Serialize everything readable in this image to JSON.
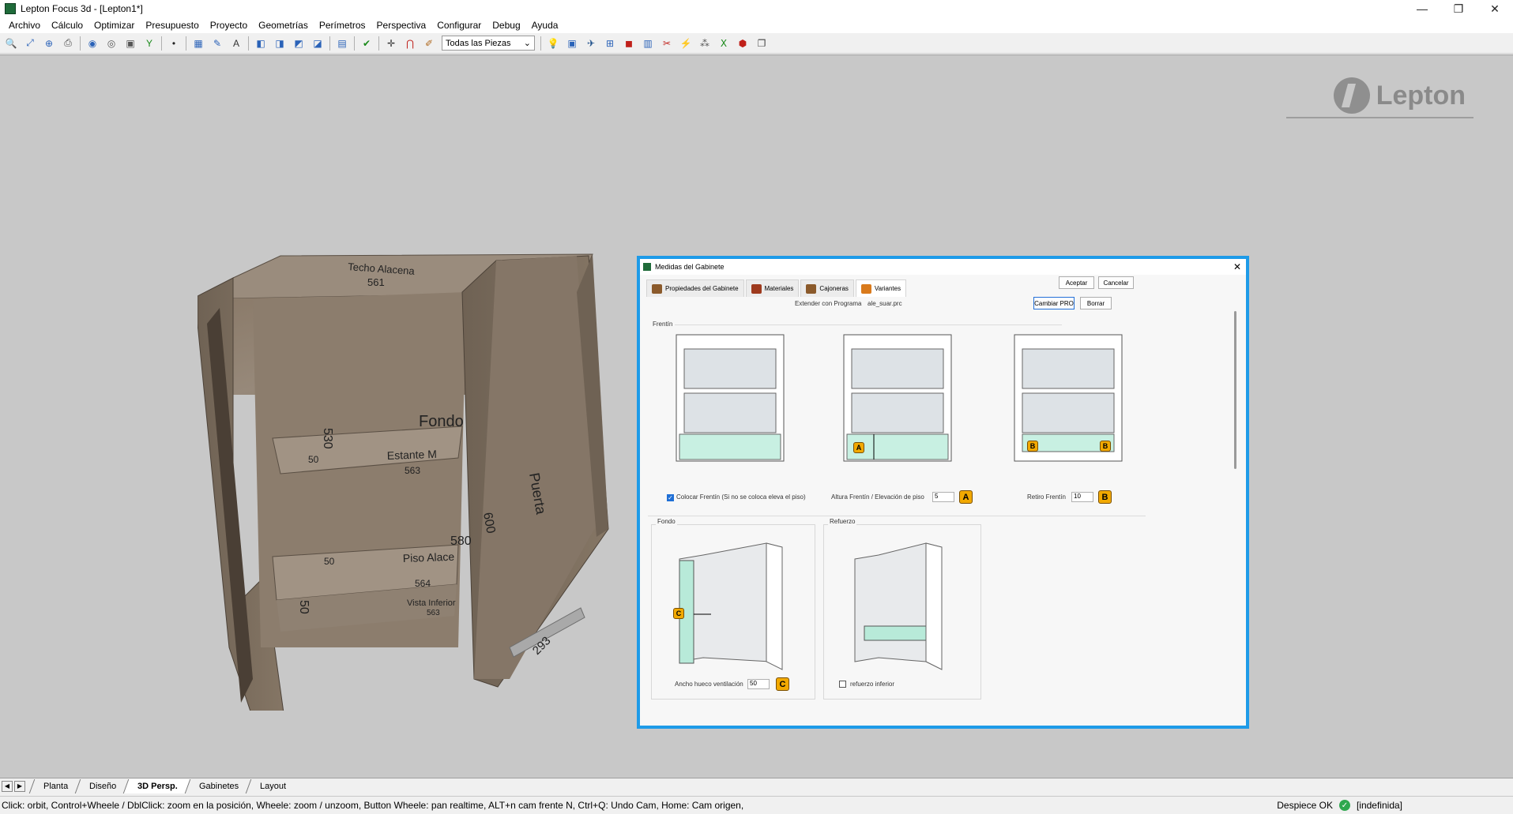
{
  "window": {
    "title": "Lepton Focus 3d - [Lepton1*]",
    "minimize": "—",
    "restore": "❐",
    "close": "✕"
  },
  "menu": [
    "Archivo",
    "Cálculo",
    "Optimizar",
    "Presupuesto",
    "Proyecto",
    "Geometrías",
    "Perímetros",
    "Perspectiva",
    "Configurar",
    "Debug",
    "Ayuda"
  ],
  "toolbar": {
    "piece_filter": "Todas las Piezas"
  },
  "logo": {
    "text": "Lepton"
  },
  "cabinet_labels": {
    "top_panel": "Techo Alacena",
    "top_dim": "561",
    "back": "Fondo",
    "back_dim_side": "530",
    "shelf": "Estante M",
    "shelf_dim": "563",
    "shelf_small": "50",
    "floor": "Piso Alace",
    "floor_dim": "564",
    "floor_small": "50",
    "bottom": "Vista Inferior",
    "bottom_dim": "563",
    "left_dim": "50",
    "door": "Puerta",
    "door_height": "600",
    "door_inner": "580",
    "door_width": "293"
  },
  "dialog": {
    "title": "Medidas del Gabinete",
    "tabs": [
      "Propiedades del Gabinete",
      "Materiales",
      "Cajoneras",
      "Variantes"
    ],
    "accept": "Aceptar",
    "cancel": "Cancelar",
    "extend_label": "Extender con Programa",
    "extend_value": "ale_suar.prc",
    "change_pro": "Cambiar PRO",
    "delete": "Borrar",
    "section_frente": "Frentín",
    "chk_colocar": "Colocar Frentín (Si no se coloca eleva el piso)",
    "height_label": "Altura Frentín / Elevación de piso",
    "height_value": "5",
    "retiro_label": "Retiro Frentín",
    "retiro_value": "10",
    "section_fondo": "Fondo",
    "hueco_label": "Ancho hueco ventilación",
    "hueco_value": "50",
    "section_refuerzo": "Refuerzo",
    "refuerzo_label": "refuerzo inferior",
    "badge_a": "A",
    "badge_b": "B",
    "badge_c": "C"
  },
  "sheet_tabs": [
    "Planta",
    "Diseño",
    "3D Persp.",
    "Gabinetes",
    "Layout"
  ],
  "active_sheet": "3D Persp.",
  "status": {
    "hint": "Click: orbit, Control+Wheele /  DblClick: zoom en la posición, Wheele: zoom / unzoom, Button Wheele: pan realtime, ALT+n cam frente N, Ctrl+Q: Undo Cam, Home: Cam origen,",
    "despiece": "Despiece OK",
    "state": "[indefinida]"
  },
  "colors": {
    "viewport": "#c8c8c8",
    "dialog_border": "#1e9be8",
    "wood": "#8b7b6a",
    "badge": "#f2a900"
  }
}
